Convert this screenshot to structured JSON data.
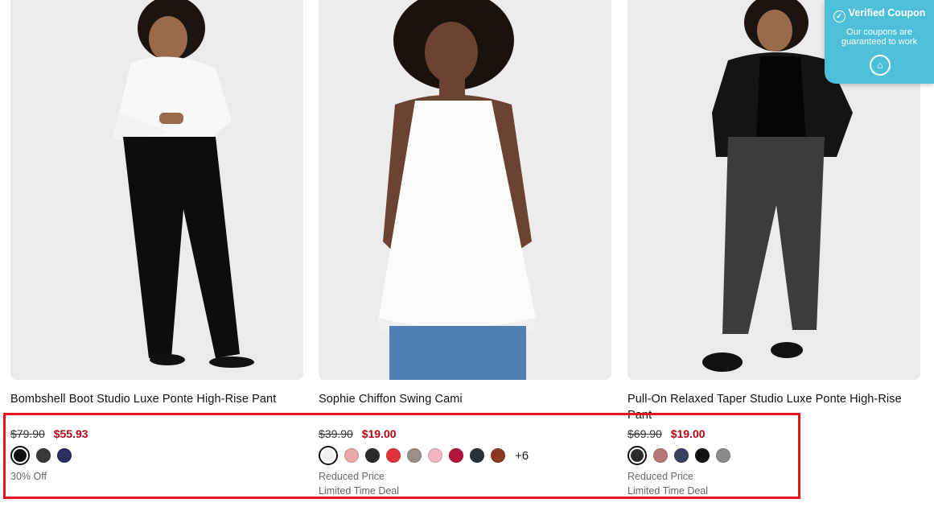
{
  "coupon": {
    "title": "Verified Coupon",
    "subtitle": "Our coupons are guaranteed to work",
    "check_icon": "✓",
    "badge_icon": "⌂",
    "color": "#4dbfd9"
  },
  "products": [
    {
      "name": "Bombshell Boot Studio Luxe Ponte High-Rise Pant",
      "original_price": "$79.90",
      "sale_price": "$55.93",
      "swatches": [
        "#111111",
        "#3a3a3a",
        "#2e2f5e"
      ],
      "selected_swatch": 0,
      "more_colors": "",
      "note_1": "30% Off",
      "note_2": ""
    },
    {
      "name": "Sophie Chiffon Swing Cami",
      "original_price": "$39.90",
      "sale_price": "$19.00",
      "swatches": [
        "#f3f3f5",
        "#e8a8a8",
        "#2a2a2a",
        "#e2323b",
        "#9a8f86",
        "#f1b6c4",
        "#b0123a",
        "#2b2f36",
        "#8a3a22"
      ],
      "selected_swatch": 0,
      "more_colors": "+6",
      "note_1": "Reduced Price",
      "note_2": "Limited Time Deal"
    },
    {
      "name": "Pull-On Relaxed Taper Studio Luxe Ponte High-Rise Pant",
      "original_price": "$69.90",
      "sale_price": "$19.00",
      "swatches": [
        "#2b2b2b",
        "#b77878",
        "#3b3f60",
        "#111111",
        "#8a8a8a"
      ],
      "selected_swatch": 0,
      "more_colors": "",
      "note_1": "Reduced Price",
      "note_2": "Limited Time Deal"
    }
  ],
  "colors": {
    "sale": "#b3001b",
    "highlight": "#e8141b"
  }
}
